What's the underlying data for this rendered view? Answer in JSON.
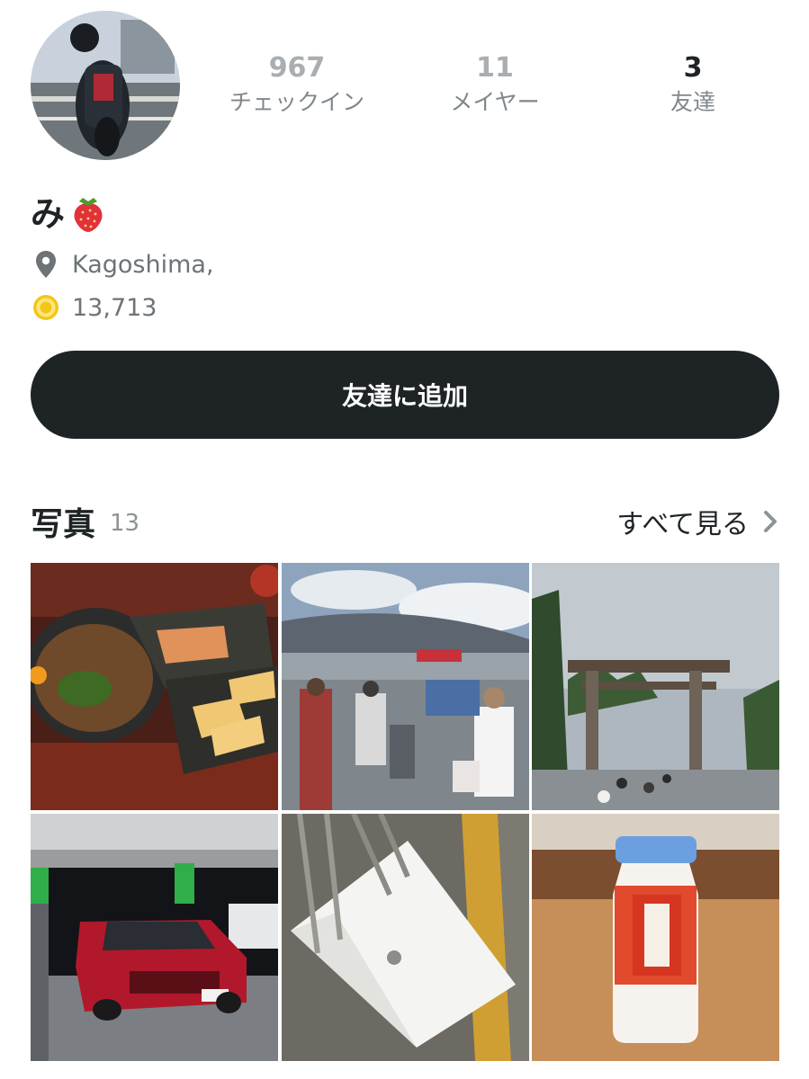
{
  "profile": {
    "username": "み",
    "location": "Kagoshima,",
    "coins": "13,713"
  },
  "stats": [
    {
      "value": "967",
      "label": "チェックイン"
    },
    {
      "value": "11",
      "label": "メイヤー"
    },
    {
      "value": "3",
      "label": "友達"
    }
  ],
  "actions": {
    "add_friend_label": "友達に追加"
  },
  "photos": {
    "title": "写真",
    "count": "13",
    "see_all_label": "すべて見る",
    "items": [
      {
        "subject": "food"
      },
      {
        "subject": "suzuka-circuit"
      },
      {
        "subject": "torii-gate"
      },
      {
        "subject": "red-car-gas-station"
      },
      {
        "subject": "white-paper-bag"
      },
      {
        "subject": "milk-bottle"
      }
    ]
  },
  "colors": {
    "primary_dark": "#1e2426",
    "muted_text": "#7f878b",
    "coin": "#f5c518"
  },
  "icons": {
    "location": "location-pin-icon",
    "coin": "coin-icon",
    "chevron": "chevron-right-icon",
    "emoji": "strawberry-icon"
  }
}
